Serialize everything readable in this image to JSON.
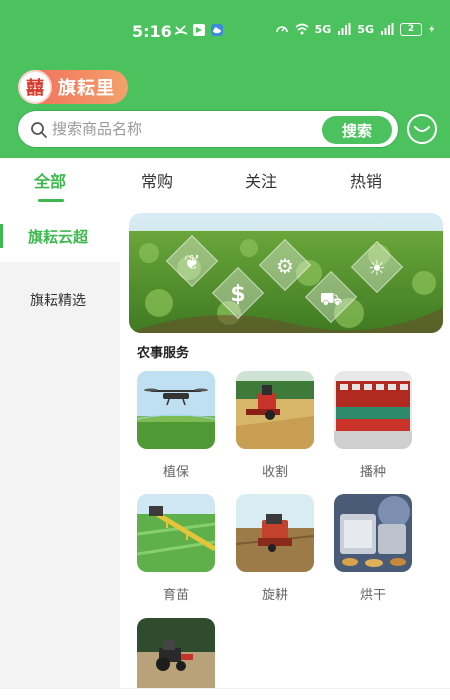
{
  "status_bar": {
    "time": "5:16",
    "net_label_1": "5G",
    "net_label_2": "5G",
    "battery": "2"
  },
  "brand": {
    "logo_glyph": "囍",
    "name": "旗耘里"
  },
  "search": {
    "placeholder": "搜索商品名称",
    "button_label": "搜索"
  },
  "tabs": [
    {
      "label": "全部",
      "active": true
    },
    {
      "label": "常购",
      "active": false
    },
    {
      "label": "关注",
      "active": false
    },
    {
      "label": "热销",
      "active": false
    }
  ],
  "sidebar": {
    "items": [
      {
        "label": "旗耘云超",
        "active": true
      },
      {
        "label": "旗耘精选",
        "active": false
      }
    ]
  },
  "main": {
    "section_title": "农事服务",
    "services": [
      {
        "label": "植保",
        "icon": "drone-image"
      },
      {
        "label": "收割",
        "icon": "harvester-image"
      },
      {
        "label": "播种",
        "icon": "seeder-image"
      },
      {
        "label": "育苗",
        "icon": "seedling-field-image"
      },
      {
        "label": "旋耕",
        "icon": "rotary-tiller-image"
      },
      {
        "label": "烘干",
        "icon": "dryer-image"
      },
      {
        "label": "",
        "icon": "tractor-image"
      }
    ]
  },
  "colors": {
    "brand_green": "#4cc25e",
    "active_green": "#3fb84f",
    "brand_orange": "#f26b5a"
  }
}
